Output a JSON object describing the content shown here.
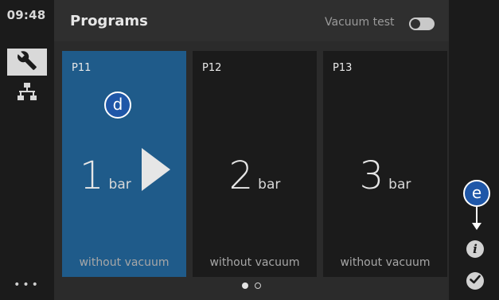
{
  "status": {
    "time": "09:48"
  },
  "header": {
    "title": "Programs",
    "vacuum_test_label": "Vacuum test"
  },
  "programs": [
    {
      "id": "P11",
      "value": "1",
      "unit": "bar",
      "mode": "without vacuum",
      "selected": true
    },
    {
      "id": "P12",
      "value": "2",
      "unit": "bar",
      "mode": "without vacuum",
      "selected": false
    },
    {
      "id": "P13",
      "value": "3",
      "unit": "bar",
      "mode": "without vacuum",
      "selected": false
    }
  ],
  "pagination": {
    "current_page": 1,
    "total_pages": 2
  },
  "annotations": {
    "d": "d",
    "e": "e"
  },
  "sidebar": {
    "more_label": "•••"
  },
  "colors": {
    "selected_card": "#1f5b8a",
    "badge": "#1f57a8",
    "background": "#1b1b1b"
  },
  "icons": {
    "sidebar_active": "wrench-icon",
    "sidebar_network": "network-icon",
    "info": "info-icon",
    "confirm": "check-icon",
    "start": "play-icon"
  }
}
